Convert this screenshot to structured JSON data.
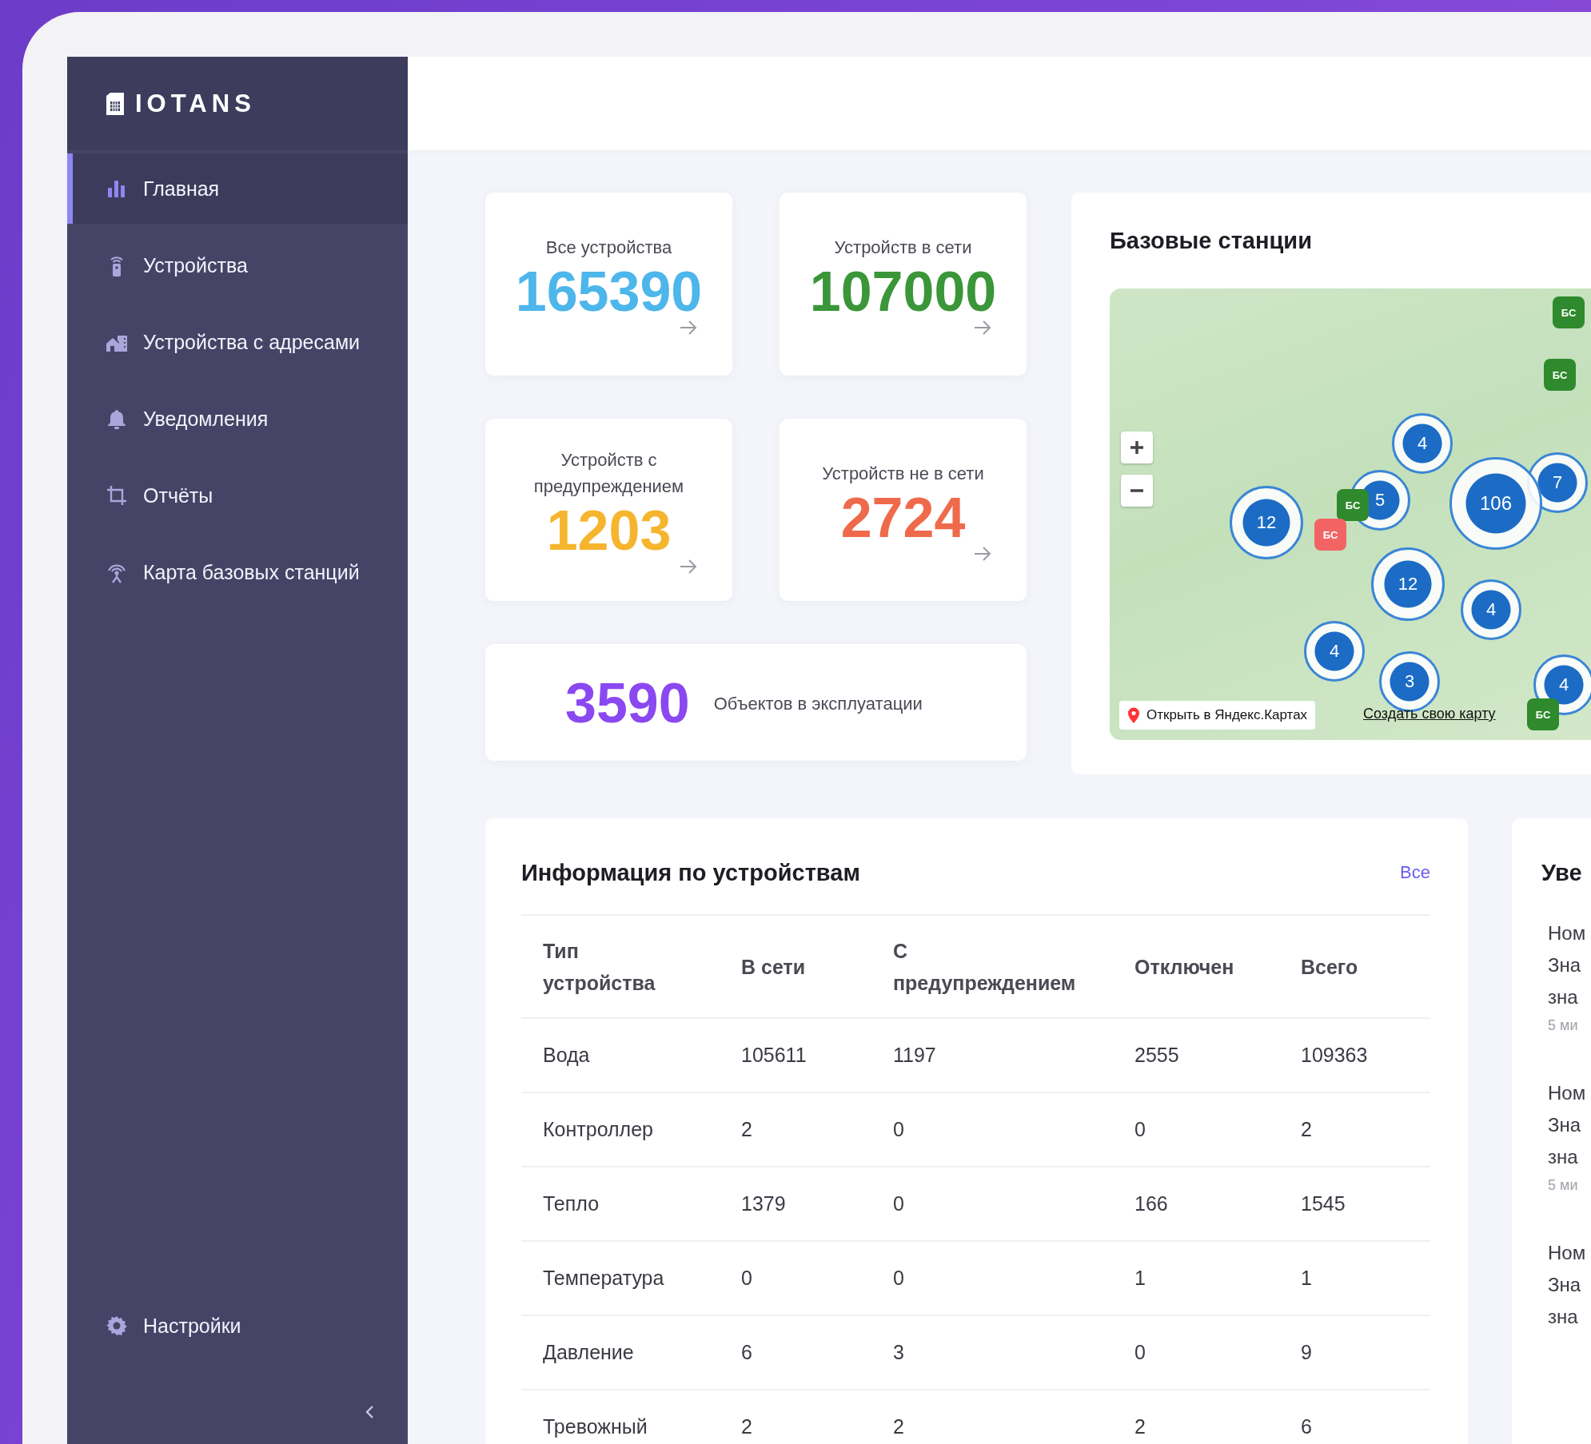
{
  "brand": {
    "name": "IOTANS"
  },
  "sidebar": {
    "items": [
      {
        "label": "Главная",
        "selected": true
      },
      {
        "label": "Устройства",
        "selected": false
      },
      {
        "label": "Устройства с адресами",
        "selected": false
      },
      {
        "label": "Уведомления",
        "selected": false
      },
      {
        "label": "Отчёты",
        "selected": false
      },
      {
        "label": "Карта базовых станций",
        "selected": false
      }
    ],
    "settings": {
      "label": "Настройки"
    }
  },
  "stats": [
    {
      "kind": "tile",
      "label": "Все устройства",
      "value": "165390",
      "color": "#4db6ea"
    },
    {
      "kind": "tile",
      "label": "Устройств в сети",
      "value": "107000",
      "color": "#3a9638"
    },
    {
      "kind": "tile",
      "label": "Устройств с предупреждением",
      "value": "1203",
      "color": "#f6b52e"
    },
    {
      "kind": "tile",
      "label": "Устройств не в сети",
      "value": "2724",
      "color": "#ef6a4a"
    },
    {
      "kind": "wide",
      "label": "Объектов в эксплуатации",
      "value": "3590",
      "color": "#8a48f0"
    }
  ],
  "map": {
    "title": "Базовые станции",
    "clusters": [
      {
        "count": "4"
      },
      {
        "count": "5"
      },
      {
        "count": "106"
      },
      {
        "count": "7"
      },
      {
        "count": "12"
      },
      {
        "count": "12"
      },
      {
        "count": "4"
      },
      {
        "count": "4"
      },
      {
        "count": "3"
      },
      {
        "count": "4"
      }
    ],
    "stations": [
      {
        "label": "БС",
        "color": "#2e8a2c"
      },
      {
        "label": "БС",
        "color": "#2e8a2c"
      },
      {
        "label": "БС",
        "color": "#2e8a2c"
      },
      {
        "label": "БС",
        "color": "#f26464"
      },
      {
        "label": "БС",
        "color": "#2e8a2c"
      }
    ],
    "open_button": "Открыть в Яндекс.Картах",
    "create_link": "Создать свою карту"
  },
  "devices_table": {
    "title": "Информация по устройствам",
    "all_link": "Все",
    "columns": [
      "Тип устройства",
      "В сети",
      "С предупреждением",
      "Отключен",
      "Всего"
    ],
    "rows": [
      [
        "Вода",
        "105611",
        "1197",
        "2555",
        "109363"
      ],
      [
        "Контроллер",
        "2",
        "0",
        "0",
        "2"
      ],
      [
        "Тепло",
        "1379",
        "0",
        "166",
        "1545"
      ],
      [
        "Температура",
        "0",
        "0",
        "1",
        "1"
      ],
      [
        "Давление",
        "6",
        "3",
        "0",
        "9"
      ],
      [
        "Тревожный",
        "2",
        "2",
        "2",
        "6"
      ]
    ]
  },
  "notifications": {
    "title": "Уве",
    "items": [
      {
        "lines": [
          "Ном",
          "Зна",
          "зна"
        ],
        "time": "5 ми"
      },
      {
        "lines": [
          "Ном",
          "Зна",
          "зна"
        ],
        "time": "5 ми"
      },
      {
        "lines": [
          "Ном",
          "Зна",
          "зна"
        ]
      }
    ]
  }
}
